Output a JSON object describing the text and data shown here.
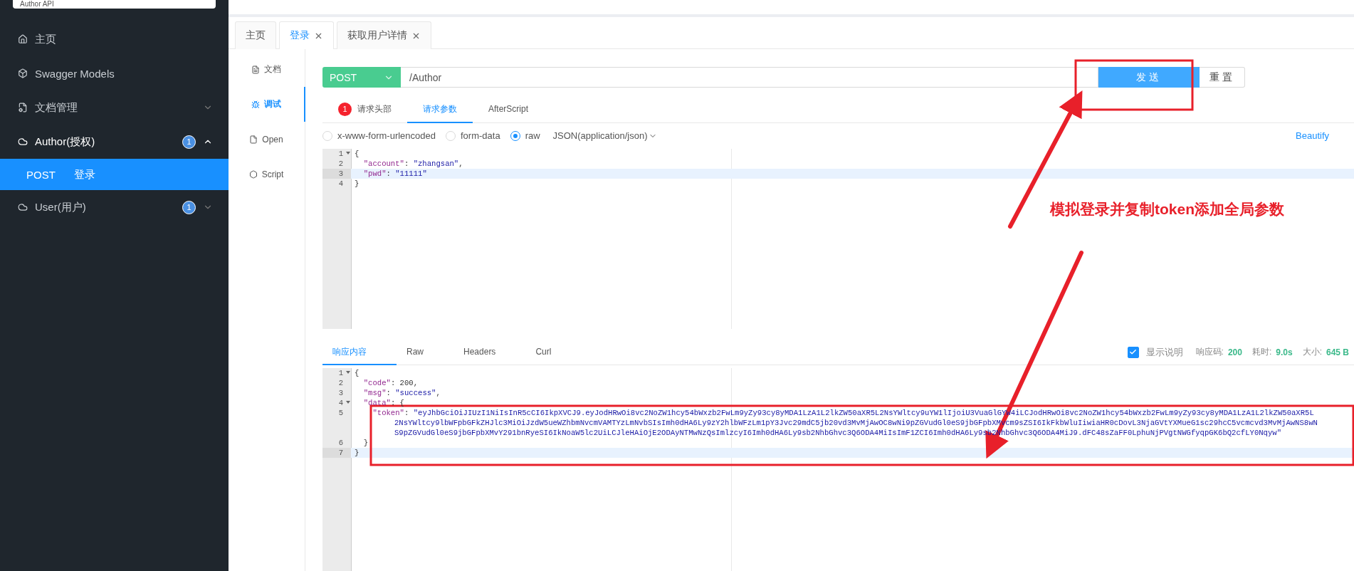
{
  "sidebar": {
    "api_select": {
      "value": "Author API"
    },
    "items": [
      {
        "kind": "link",
        "label": "主页"
      },
      {
        "kind": "link",
        "label": "Swagger Models"
      },
      {
        "kind": "group",
        "label": "文档管理",
        "expanded": false
      },
      {
        "kind": "group",
        "label": "Author(授权)",
        "badge": "1",
        "expanded": true,
        "children": [
          {
            "method": "POST",
            "label": "登录",
            "selected": true
          }
        ]
      },
      {
        "kind": "group",
        "label": "User(用户)",
        "badge": "1",
        "expanded": false
      }
    ]
  },
  "tabs": [
    {
      "label": "主页",
      "closable": false,
      "selected": false
    },
    {
      "label": "登录",
      "closable": true,
      "selected": true
    },
    {
      "label": "获取用户详情",
      "closable": true,
      "selected": false
    }
  ],
  "sub_nav": [
    {
      "label": "文档",
      "selected": false
    },
    {
      "label": "调试",
      "selected": true
    },
    {
      "label": "Open",
      "selected": false
    },
    {
      "label": "Script",
      "selected": false
    }
  ],
  "request": {
    "method": "POST",
    "url": "/Author",
    "send": "发送",
    "reset": "重置",
    "tabs": [
      {
        "label": "请求头部",
        "badge": "1",
        "selected": false
      },
      {
        "label": "请求参数",
        "selected": true
      },
      {
        "label": "AfterScript",
        "selected": false
      }
    ],
    "body_types": [
      {
        "label": "x-www-form-urlencoded",
        "selected": false
      },
      {
        "label": "form-data",
        "selected": false
      },
      {
        "label": "raw",
        "selected": true
      }
    ],
    "content_type": "JSON(application/json)",
    "beautify": "Beautify",
    "lines": [
      {
        "number": "1",
        "text": "{",
        "foldable": true,
        "active": false
      },
      {
        "number": "2",
        "text": "  \"account\": \"zhangsan\",",
        "foldable": false,
        "active": false
      },
      {
        "number": "3",
        "text": "  \"pwd\": \"11111\"",
        "foldable": false,
        "active": true
      },
      {
        "number": "4",
        "text": "}",
        "foldable": false,
        "active": false
      }
    ]
  },
  "response": {
    "tabs": [
      {
        "label": "响应内容",
        "selected": true
      },
      {
        "label": "Raw",
        "selected": false
      },
      {
        "label": "Headers",
        "selected": false
      },
      {
        "label": "Curl",
        "selected": false
      }
    ],
    "show_description": {
      "label": "显示说明",
      "checked": true
    },
    "stats": [
      {
        "label": "响应码:",
        "value": "200"
      },
      {
        "label": "耗时:",
        "value": "9.0s"
      },
      {
        "label": "大小:",
        "value": "645 B"
      }
    ],
    "lines": [
      {
        "number": "1",
        "text": "{",
        "foldable": true,
        "active": false
      },
      {
        "number": "2",
        "text": "  \"code\": 200,",
        "foldable": false,
        "active": false
      },
      {
        "number": "3",
        "text": "  \"msg\": \"success\",",
        "foldable": false,
        "active": false
      },
      {
        "number": "4",
        "text": "  \"data\": {",
        "foldable": true,
        "active": false
      },
      {
        "number": "5",
        "text": "    \"token\": \"eyJhbGciOiJIUzI1NiIsInR5cCI6IkpXVCJ9.eyJodHRwOi8vc2NoZW1hcy54bWxzb2FwLm9yZy93cy8yMDA1LzA1L2lkZW50aXR5L2NsYWltcy9uYW1lIjoiU3VuaGlGYW4iLCJodHRwOi8vc2NoZW1hcy54bWxzb2FwLm9yZy93cy8yMDA1LzA1L2lkZW50aXR5L",
        "wrap": [
          "2NsYWltcy9lbWFpbGFkZHJlc3MiOiJzdW5ueWZhbmNvcmVAMTYzLmNvbSIsImh0dHA6Ly9zY2hlbWFzLm1pY3Jvc29mdC5jb20vd3MvMjAwOC8wNi9pZGVudGl0eS9jbGFpbXMvcm9sZSI6IkFkbWluIiwiaHR0cDovL3NjaGVtYXMueG1sc29hcC5vcmcvd3MvMjAwNS8wN",
          "S9pZGVudGl0eS9jbGFpbXMvY291bnRyeSI6IkNoaW5lc2UiLCJleHAiOjE2ODAyNTMwNzQsImlzcyI6Imh0dHA6Ly9sb2NhbGhvc3Q6ODA4MiIsImF1ZCI6Imh0dHA6Ly9sb2NhbGhvc3Q6ODA4MiJ9.dFC48sZaFF0LphuNjPVgtNWGfyqpGK6bQ2cfLY0Nqyw\""
        ],
        "foldable": false,
        "active": false
      },
      {
        "number": "6",
        "text": "  }",
        "foldable": false,
        "active": false
      },
      {
        "number": "7",
        "text": "}",
        "foldable": false,
        "active": true
      }
    ]
  },
  "annotation": {
    "text": "模拟登录并复制token添加全局参数"
  }
}
